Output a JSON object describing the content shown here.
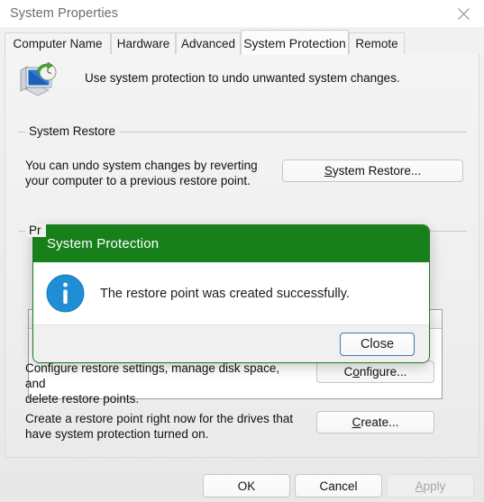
{
  "window": {
    "title": "System Properties",
    "close_icon": "close-icon"
  },
  "tabs": [
    {
      "label": "Computer Name",
      "active": false
    },
    {
      "label": "Hardware",
      "active": false
    },
    {
      "label": "Advanced",
      "active": false
    },
    {
      "label": "System Protection",
      "active": true
    },
    {
      "label": "Remote",
      "active": false
    }
  ],
  "header": {
    "icon": "system-restore-icon",
    "text": "Use system protection to undo unwanted system changes."
  },
  "system_restore_group": {
    "label": "System Restore",
    "description_line1": "You can undo system changes by reverting",
    "description_line2": "your computer to a previous restore point.",
    "button": {
      "accel": "S",
      "rest": "ystem Restore..."
    }
  },
  "protection_settings_group": {
    "label": "Pr",
    "configure_line1": "Configure restore settings, manage disk space, and",
    "configure_line2": "delete restore points.",
    "configure_button": {
      "pre": "C",
      "accel": "o",
      "rest": "nfigure..."
    },
    "create_line1": "Create a restore point right now for the drives that",
    "create_line2": "have system protection turned on.",
    "create_button": {
      "accel": "C",
      "rest": "reate..."
    }
  },
  "footer": {
    "ok": "OK",
    "cancel": "Cancel",
    "apply": {
      "accel": "A",
      "rest": "pply",
      "disabled": true
    }
  },
  "modal": {
    "title": "System Protection",
    "icon": "info-icon",
    "message": "The restore point was created successfully.",
    "close_button": "Close"
  },
  "colors": {
    "modal_titlebar_green": "#17801b",
    "info_icon_blue": "#1f8ed4",
    "window_bg": "#f0f0f0",
    "default_button_border_blue": "#3a7ca8"
  }
}
